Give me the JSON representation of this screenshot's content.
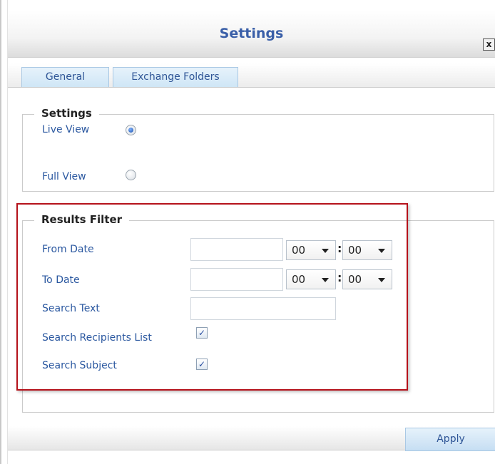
{
  "dialog": {
    "title": "Settings",
    "close_label": "x"
  },
  "tabs": [
    {
      "label": "General",
      "active": true
    },
    {
      "label": "Exchange Folders",
      "active": false
    }
  ],
  "settings_group": {
    "legend": "Settings",
    "options": [
      {
        "label": "Live View",
        "selected": true
      },
      {
        "label": "Full View",
        "selected": false
      }
    ]
  },
  "filter_group": {
    "legend": "Results Filter",
    "from_date": {
      "label": "From Date",
      "value": "",
      "hour": "00",
      "minute": "00",
      "separator": ":"
    },
    "to_date": {
      "label": "To Date",
      "value": "",
      "hour": "00",
      "minute": "00",
      "separator": ":"
    },
    "search_text": {
      "label": "Search Text",
      "value": ""
    },
    "search_recipients": {
      "label": "Search Recipients List",
      "checked": true
    },
    "search_subject": {
      "label": "Search Subject",
      "checked": true
    }
  },
  "checkmark_glyph": "✓",
  "footer": {
    "apply_label": "Apply"
  },
  "colors": {
    "label_blue": "#2b58a0",
    "highlight_red": "#b5121b",
    "tab_blue": "#cfe6f6"
  }
}
